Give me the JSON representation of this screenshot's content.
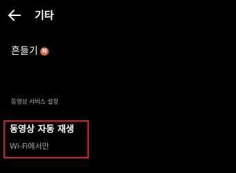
{
  "header": {
    "back_icon": "arrow-left-icon",
    "title": "기타"
  },
  "shake": {
    "label": "흔들기",
    "badge_text": "N",
    "badge_color": "#e8643c"
  },
  "video_section": {
    "header": "동영상 서비스 설정",
    "autoplay": {
      "title": "동영상 자동 재생",
      "value": "Wi-Fi에서만"
    }
  },
  "colors": {
    "background": "#000000",
    "highlight": "#e21b23",
    "secondary_text": "#a8a8a8"
  }
}
